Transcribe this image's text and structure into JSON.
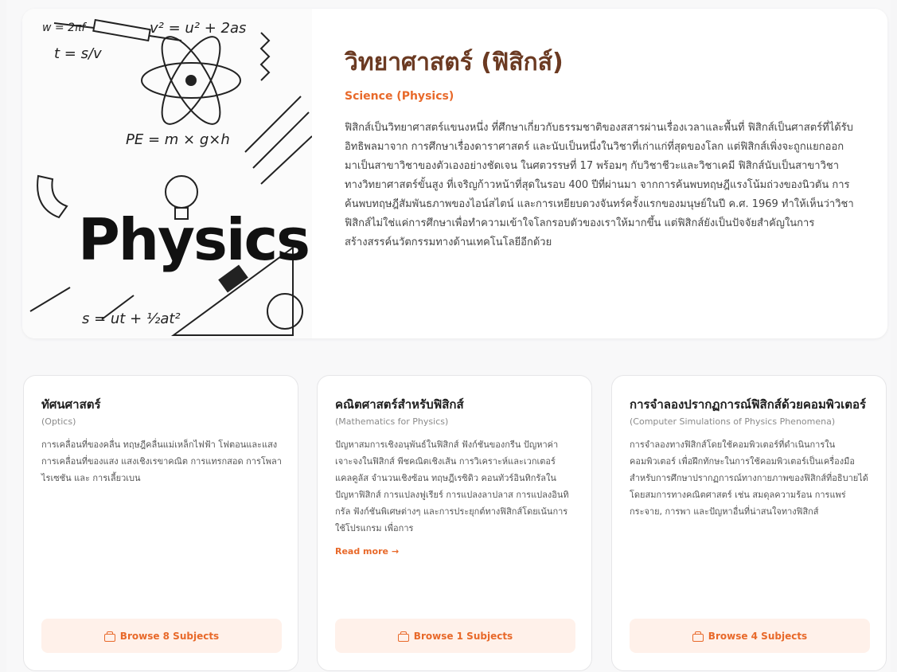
{
  "hero": {
    "title": "วิทยาศาสตร์ (ฟิสิกส์)",
    "subtitle": "Science (Physics)",
    "description": "ฟิสิกส์เป็นวิทยาศาสตร์แขนงหนึ่ง ที่ศึกษาเกี่ยวกับธรรมชาติของสสารผ่านเรื่องเวลาและพื้นที่ ฟิสิกส์เป็นศาสตร์ที่ได้รับอิทธิพลมาจาก การศึกษาเรื่องดาราศาสตร์ และนับเป็นหนึ่งในวิชาที่เก่าแก่ที่สุดของโลก แต่ฟิสิกส์เพิ่งจะถูกแยกออกมาเป็นสาขาวิชาของตัวเองอย่างชัดเจน ในศตวรรษที่ 17 พร้อมๆ กับวิชาชีวะและวิชาเคมี ฟิสิกส์นับเป็นสาขาวิชาทางวิทยาศาสตร์ขั้นสูง ที่เจริญก้าวหน้าที่สุดในรอบ 400 ปีที่ผ่านมา จากการค้นพบทฤษฎีแรงโน้มถ่วงของนิวตัน การค้นพบทฤษฎีสัมพันธภาพของไอน์สไตน์ และการเหยียบดวงจันทร์ครั้งแรกของมนุษย์ในปี ค.ศ. 1969 ทำให้เห็นว่าวิชาฟิสิกส์ไม่ใช่แค่การศึกษาเพื่อทำความเข้าใจโลกรอบตัวของเราให้มากขึ้น แต่ฟิสิกส์ยังเป็นปัจจัยสำคัญในการสร้างสรรค์นวัตกรรมทางด้านเทคโนโลยีอีกด้วย",
    "image": {
      "word": "Physics",
      "formulas": [
        "v² = u² + 2as",
        "PE = m × g×h",
        "s = ut + ½at²",
        "t = s/v",
        "w = 2πf"
      ],
      "icon": "physics-doodle-image"
    }
  },
  "cards": [
    {
      "title": "ทัศนศาสตร์",
      "subtitle": "(Optics)",
      "description": "การเคลื่อนที่ของคลื่น ทฤษฎีคลื่นแม่เหล็กไฟฟ้า โฟตอนและแสง การเคลื่อนที่ของแสง แสงเชิงเรขาคณิต การแทรกสอด การโพลาไรเซชัน และ การเลี้ยวเบน",
      "read_more": "",
      "button_label": "Browse 8 Subjects"
    },
    {
      "title": "คณิตศาสตร์สำหรับฟิสิกส์",
      "subtitle": "(Mathematics for Physics)",
      "description": "ปัญหาสมการเชิงอนุพันธ์ในฟิสิกส์ ฟังก์ชันของกรีน ปัญหาค่าเจาะจงในฟิสิกส์ พีชคณิตเชิงเส้น การวิเคราะห์และเวกเตอร์แคลคูลัส จำนวนเชิงซ้อน ทฤษฎีเรซิดิว คอนทัวร์อินทิกรัลในปัญหาฟิสิกส์ การแปลงฟูเรียร์ การแปลงลาปลาส การแปลงอินทิกรัล ฟังก์ชันพิเศษต่างๆ และการประยุกต์ทางฟิสิกส์โดยเน้นการใช้โปรแกรม เพื่อการ",
      "read_more": "Read more",
      "read_more_arrow": "→",
      "button_label": "Browse 1 Subjects"
    },
    {
      "title": "การจำลองปรากฏการณ์ฟิสิกส์ด้วยคอมพิวเตอร์",
      "subtitle": "(Computer Simulations of Physics Phenomena)",
      "description": "การจำลองทางฟิสิกส์โดยใช้คอมพิวเตอร์ที่ดำเนินการในคอมพิวเตอร์ เพื่อฝึกทักษะในการใช้คอมพิวเตอร์เป็นเครื่องมือสำหรับการศึกษาปรากฏการณ์ทางกายภาพของฟิสิกส์ที่อธิบายได้โดยสมการทางคณิตศาสตร์ เช่น สมดุลความร้อน การแพร่กระจาย, การพา และปัญหาอื่นที่น่าสนใจทางฟิสิกส์",
      "read_more": "",
      "button_label": "Browse 4 Subjects"
    }
  ],
  "colors": {
    "title_brown": "#6b3a22",
    "accent_orange": "#e8692a",
    "button_bg": "#fff1ea"
  }
}
